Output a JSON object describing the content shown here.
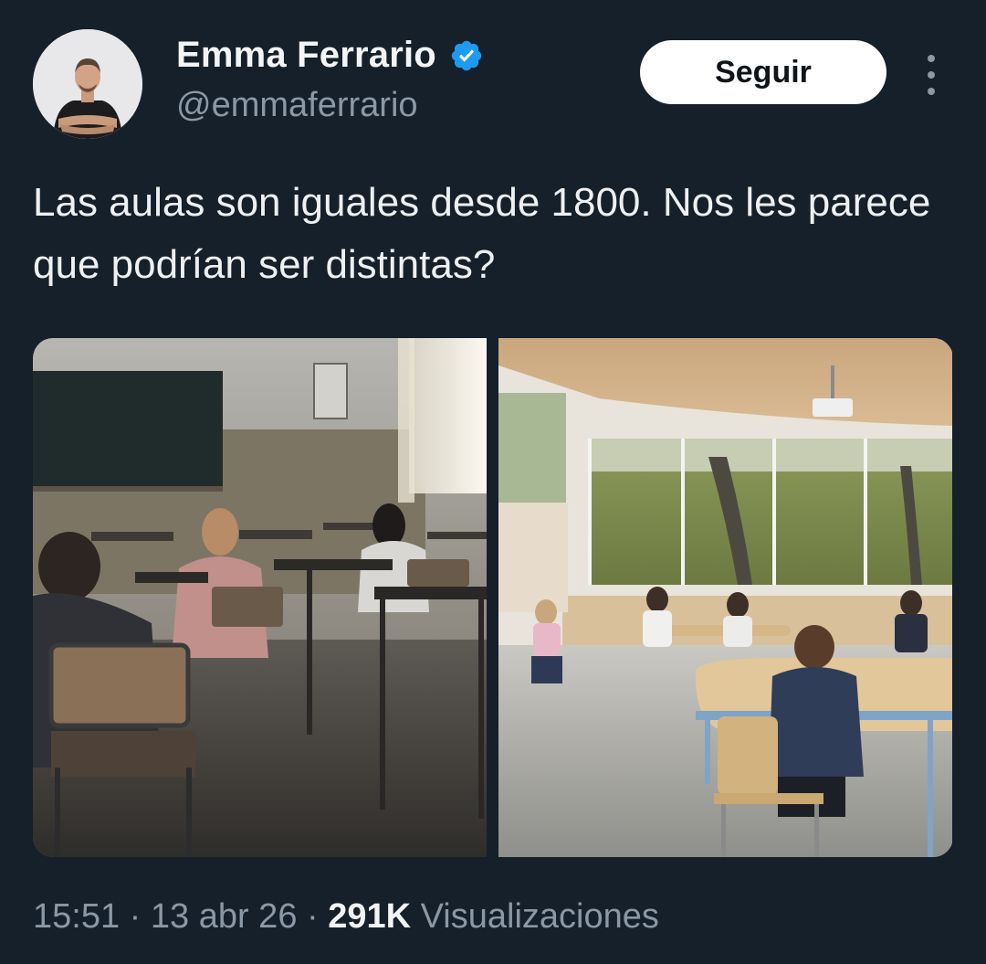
{
  "author": {
    "name": "Emma Ferrario",
    "handle": "@emmaferrario",
    "verified": true,
    "verified_color": "#1d9bf0",
    "avatar_icon": "person-avatar"
  },
  "actions": {
    "follow_label": "Seguir",
    "more_icon": "more-vertical-icon"
  },
  "tweet": {
    "text": "Las aulas son iguales desde 1800. Nos les parece que podrían ser distintas?"
  },
  "media": [
    {
      "name": "traditional-classroom-photo"
    },
    {
      "name": "modern-classroom-photo"
    }
  ],
  "meta": {
    "time": "15:51",
    "separator": "·",
    "date": "13 abr 26",
    "views_count": "291K",
    "views_label": "Visualizaciones"
  },
  "colors": {
    "background": "#15202b",
    "text": "#e7e9ea",
    "secondary": "#8b98a5",
    "button_bg": "#ffffff"
  }
}
